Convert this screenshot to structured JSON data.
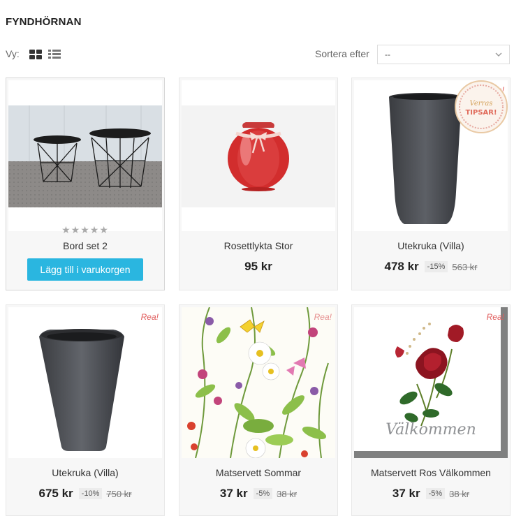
{
  "page": {
    "title": "FYNDHÖRNAN"
  },
  "toolbar": {
    "view_label": "Vy:",
    "sort_label": "Sortera efter",
    "sort_value": "--"
  },
  "badge": {
    "text_top": "Verras",
    "text_bottom": "TIPSAR!"
  },
  "products": [
    {
      "name": "Bord set 2",
      "rating": "★★★★★",
      "add_to_cart": "Lägg till i varukorgen"
    },
    {
      "name": "Rosettlykta Stor",
      "price": "95 kr"
    },
    {
      "name": "Utekruka (Villa)",
      "price": "478 kr",
      "discount": "-15%",
      "old_price": "563 kr",
      "sale": "Rea!"
    },
    {
      "name": "Utekruka (Villa)",
      "price": "675 kr",
      "discount": "-10%",
      "old_price": "750 kr",
      "sale": "Rea!"
    },
    {
      "name": "Matservett Sommar",
      "price": "37 kr",
      "discount": "-5%",
      "old_price": "38 kr",
      "sale": "Rea!"
    },
    {
      "name": "Matservett Ros Välkommen",
      "price": "37 kr",
      "discount": "-5%",
      "old_price": "38 kr",
      "sale": "Rea!",
      "image_text": "Välkommen"
    }
  ]
}
